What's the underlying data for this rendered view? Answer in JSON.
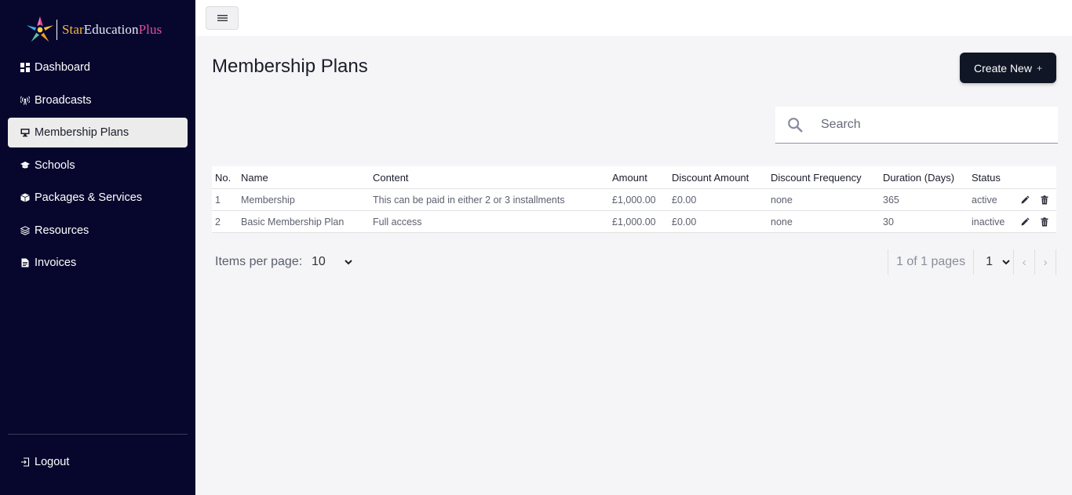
{
  "brand": {
    "part1": "Star",
    "part2": "Education",
    "part3": "Plus"
  },
  "colors": {
    "sidebar": "#07072e",
    "active_item": "#ececec",
    "primary_button": "#111626",
    "brand_gold": "#f6b73c",
    "brand_pink": "#e04f9c"
  },
  "sidebar": {
    "items": [
      {
        "label": "Dashboard",
        "icon": "dashboard-icon"
      },
      {
        "label": "Broadcasts",
        "icon": "broadcast-icon"
      },
      {
        "label": "Membership Plans",
        "icon": "monitor-icon",
        "active": true
      },
      {
        "label": "Schools",
        "icon": "graduation-cap-icon"
      },
      {
        "label": "Packages & Services",
        "icon": "package-icon"
      },
      {
        "label": "Resources",
        "icon": "layers-icon"
      },
      {
        "label": "Invoices",
        "icon": "document-icon"
      }
    ],
    "logout": {
      "label": "Logout",
      "icon": "logout-icon"
    }
  },
  "header": {
    "menu_icon": "hamburger-icon"
  },
  "main": {
    "title": "Membership Plans",
    "create_button": {
      "label": "Create New",
      "icon": "plus-icon",
      "icon_glyph": "+"
    },
    "search": {
      "placeholder": "Search",
      "icon": "search-icon"
    },
    "table": {
      "columns": [
        "No.",
        "Name",
        "Content",
        "Amount",
        "Discount Amount",
        "Discount Frequency",
        "Duration (Days)",
        "Status"
      ],
      "rows": [
        {
          "no": "1",
          "name": "Membership",
          "content": "This can be paid in either 2 or 3 installments",
          "amount": "£1,000.00",
          "discount_amount": "£0.00",
          "discount_frequency": "none",
          "duration": "365",
          "status": "active"
        },
        {
          "no": "2",
          "name": "Basic Membership Plan",
          "content": "Full access",
          "amount": "£1,000.00",
          "discount_amount": "£0.00",
          "discount_frequency": "none",
          "duration": "30",
          "status": "inactive"
        }
      ],
      "row_actions": [
        "edit-icon",
        "trash-icon"
      ]
    },
    "pagination": {
      "items_per_page_label": "Items per page:",
      "items_per_page": "10",
      "pages_text": "1 of 1 pages",
      "current_page": "1",
      "prev_glyph": "‹",
      "next_glyph": "›"
    }
  }
}
